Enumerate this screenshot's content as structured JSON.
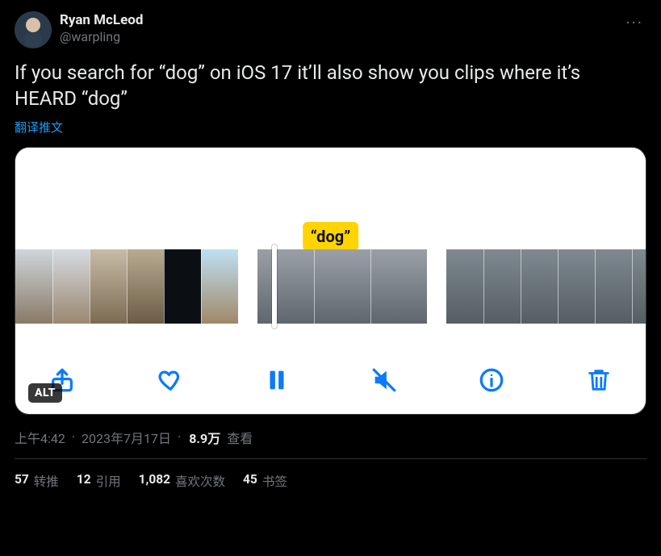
{
  "author": {
    "display_name": "Ryan McLeod",
    "handle": "@warpling"
  },
  "more_glyph": "···",
  "body": "If you search for “dog” on iOS 17 it’ll also show you clips where it’s HEARD “dog”",
  "translate_label": "翻译推文",
  "media": {
    "tag_label": "“dog”",
    "alt_badge": "ALT",
    "toolbar": {
      "share": "share",
      "heart": "heart",
      "pause": "pause",
      "mute": "mute",
      "info": "info",
      "trash": "trash"
    }
  },
  "meta": {
    "time": "上午4:42",
    "date": "2023年7月17日",
    "views_number": "8.9万",
    "views_label": "查看"
  },
  "stats": {
    "retweets": {
      "num": "57",
      "label": "转推"
    },
    "quotes": {
      "num": "12",
      "label": "引用"
    },
    "likes": {
      "num": "1,082",
      "label": "喜欢次数"
    },
    "bookmarks": {
      "num": "45",
      "label": "书签"
    }
  }
}
